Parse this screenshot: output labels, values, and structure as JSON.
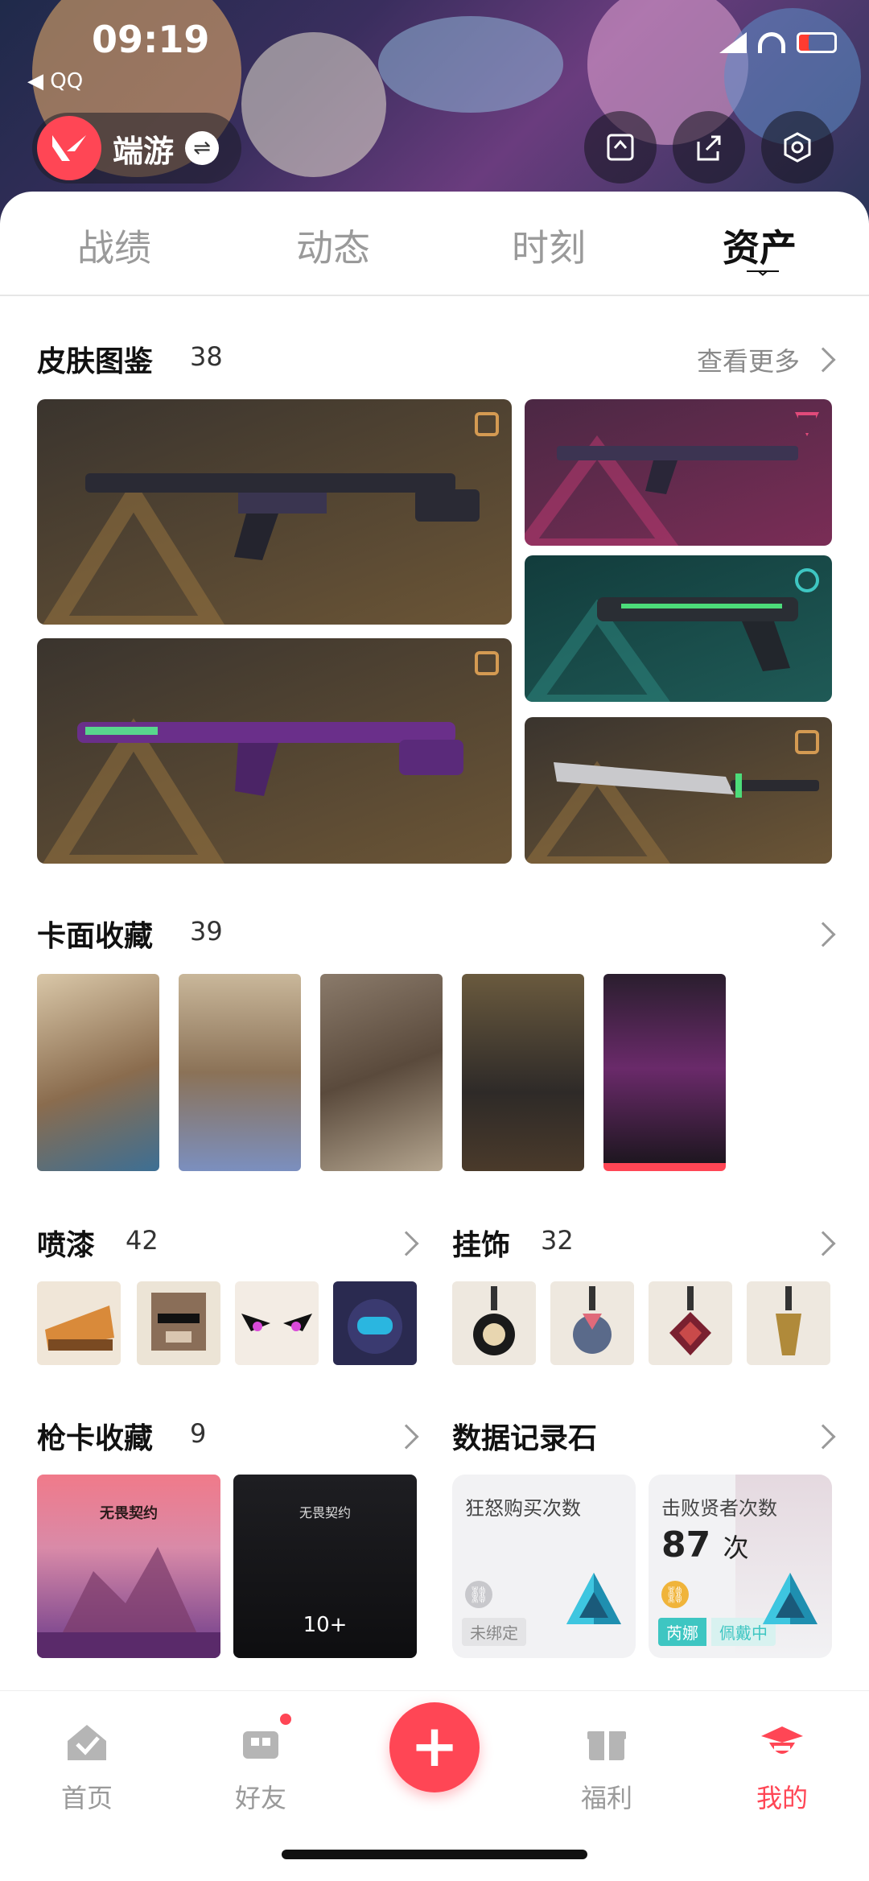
{
  "status": {
    "time": "09:19",
    "back_app": "◀ QQ"
  },
  "header": {
    "game_name": "端游",
    "swap_glyph": "⇌"
  },
  "tabs": [
    "战绩",
    "动态",
    "时刻",
    "资产"
  ],
  "active_tab": "资产",
  "skins": {
    "title": "皮肤图鉴",
    "count": "38",
    "more": "查看更多"
  },
  "cards": {
    "title": "卡面收藏",
    "count": "39"
  },
  "sprays": {
    "title": "喷漆",
    "count": "42"
  },
  "charms": {
    "title": "挂饰",
    "count": "32"
  },
  "gun_cards": {
    "title": "枪卡收藏",
    "count": "9",
    "card2_title": "无畏契约",
    "card2_more": "10+",
    "card1_title": "无畏契约"
  },
  "data_stones": {
    "title": "数据记录石",
    "stone1": {
      "label": "狂怒购买次数",
      "tag": "未绑定"
    },
    "stone2": {
      "label": "击败贤者次数",
      "value": "87",
      "unit": "次",
      "tag_agent": "芮娜",
      "tag_status": "佩戴中"
    }
  },
  "nav": {
    "home": "首页",
    "friends": "好友",
    "welfare": "福利",
    "mine": "我的"
  },
  "colors": {
    "accent": "#ff4655",
    "teal": "#3ec6c2"
  }
}
